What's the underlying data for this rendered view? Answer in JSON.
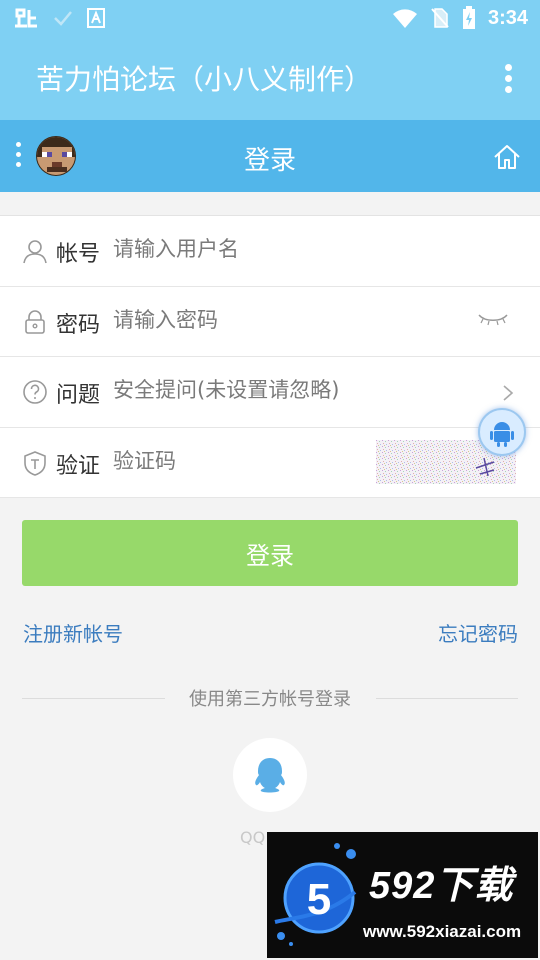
{
  "status_bar": {
    "time": "3:34",
    "left_icons": [
      "app-notification-icon",
      "check-icon",
      "translate-icon"
    ],
    "right_icons": [
      "wifi-icon",
      "no-sim-icon",
      "battery-charging-icon"
    ]
  },
  "app_bar": {
    "title": "苦力怕论坛（小八义制作）"
  },
  "sub_header": {
    "title": "登录"
  },
  "form": {
    "username": {
      "label": "帐号",
      "placeholder": "请输入用户名"
    },
    "password": {
      "label": "密码",
      "placeholder": "请输入密码"
    },
    "question": {
      "label": "问题",
      "placeholder": "安全提问(未设置请忽略)"
    },
    "captcha": {
      "label": "验证",
      "placeholder": "验证码"
    }
  },
  "actions": {
    "login_label": "登录",
    "register_label": "注册新帐号",
    "forgot_label": "忘记密码"
  },
  "third_party": {
    "divider_text": "使用第三方帐号登录",
    "qq_label": "QQ"
  },
  "watermark": {
    "brand": "592下载",
    "url": "www.592xiazai.com",
    "logo_digit": "5"
  },
  "colors": {
    "app_bar": "#7fd0f3",
    "sub_header": "#52b6ea",
    "login_button": "#97d96a",
    "link": "#3b7cbf"
  }
}
